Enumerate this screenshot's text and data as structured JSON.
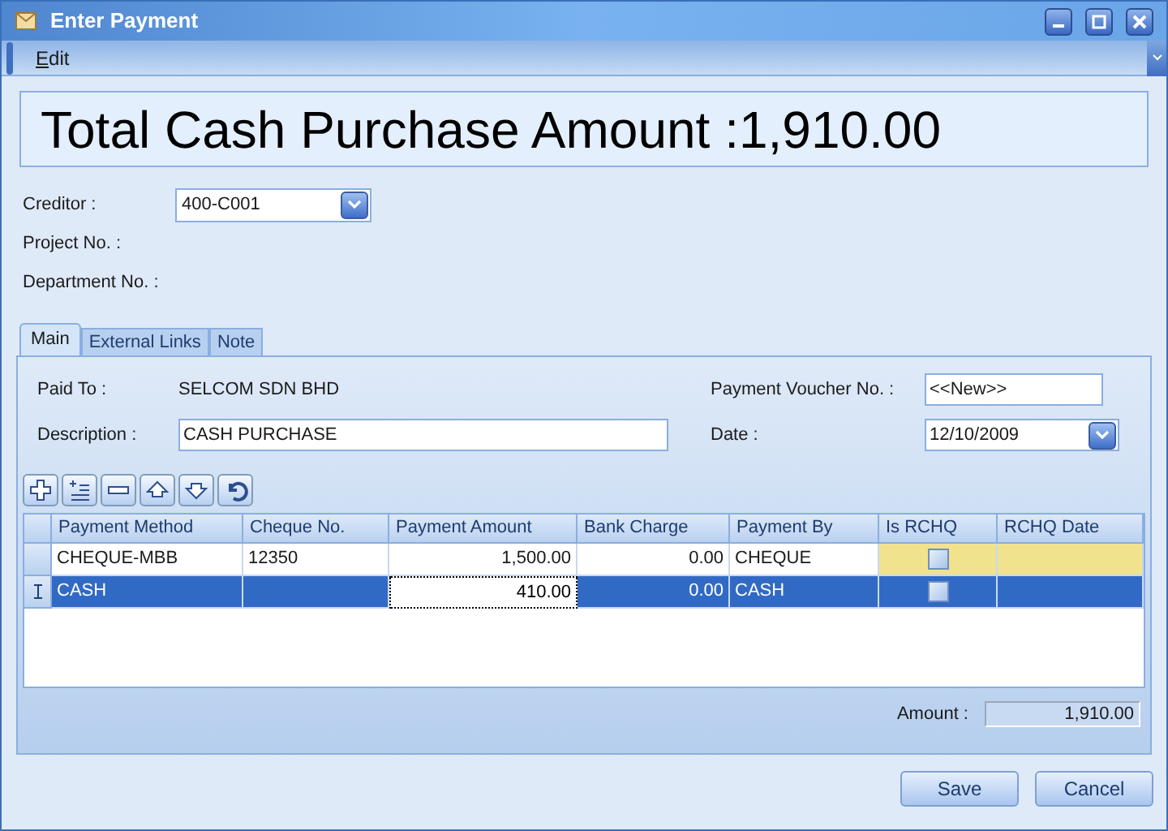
{
  "window": {
    "title": "Enter Payment"
  },
  "menu": [
    {
      "label": "Edit"
    }
  ],
  "headline": "Total Cash Purchase Amount :1,910.00",
  "header_fields": [
    {
      "label": "Creditor :",
      "value": "400-C001",
      "kind": "combo"
    },
    {
      "label": "Project No. :",
      "kind": "label"
    },
    {
      "label": "Department No. :",
      "kind": "label"
    }
  ],
  "tabs": [
    {
      "label": "Main",
      "selected": true
    },
    {
      "label": "External Links",
      "selected": false
    },
    {
      "label": "Note",
      "selected": false
    }
  ],
  "paid_to": {
    "label": "Paid To :",
    "value": "SELCOM SDN BHD"
  },
  "description": {
    "label": "Description :",
    "value": "CASH PURCHASE"
  },
  "voucher": {
    "label": "Payment Voucher No. :",
    "value": "<<New>>"
  },
  "date": {
    "label": "Date :",
    "value": "12/10/2009"
  },
  "grid": {
    "columns": [
      "Payment Method",
      "Cheque No.",
      "Payment Amount",
      "Bank Charge",
      "Payment By",
      "Is RCHQ",
      "RCHQ Date"
    ],
    "rows": [
      {
        "method": "CHEQUE-MBB",
        "cheque_no": "12350",
        "amount": "1,500.00",
        "bank_charge": "0.00",
        "payment_by": "CHEQUE",
        "is_rchq": false,
        "rchq_editable": true,
        "selected": false
      },
      {
        "method": "CASH",
        "cheque_no": "",
        "amount": "410.00",
        "bank_charge": "0.00",
        "payment_by": "CASH",
        "is_rchq": false,
        "selected": true
      }
    ]
  },
  "total": {
    "label": "Amount :",
    "value": "1,910.00"
  },
  "buttons": [
    {
      "label": "Save"
    },
    {
      "label": "Cancel"
    }
  ]
}
